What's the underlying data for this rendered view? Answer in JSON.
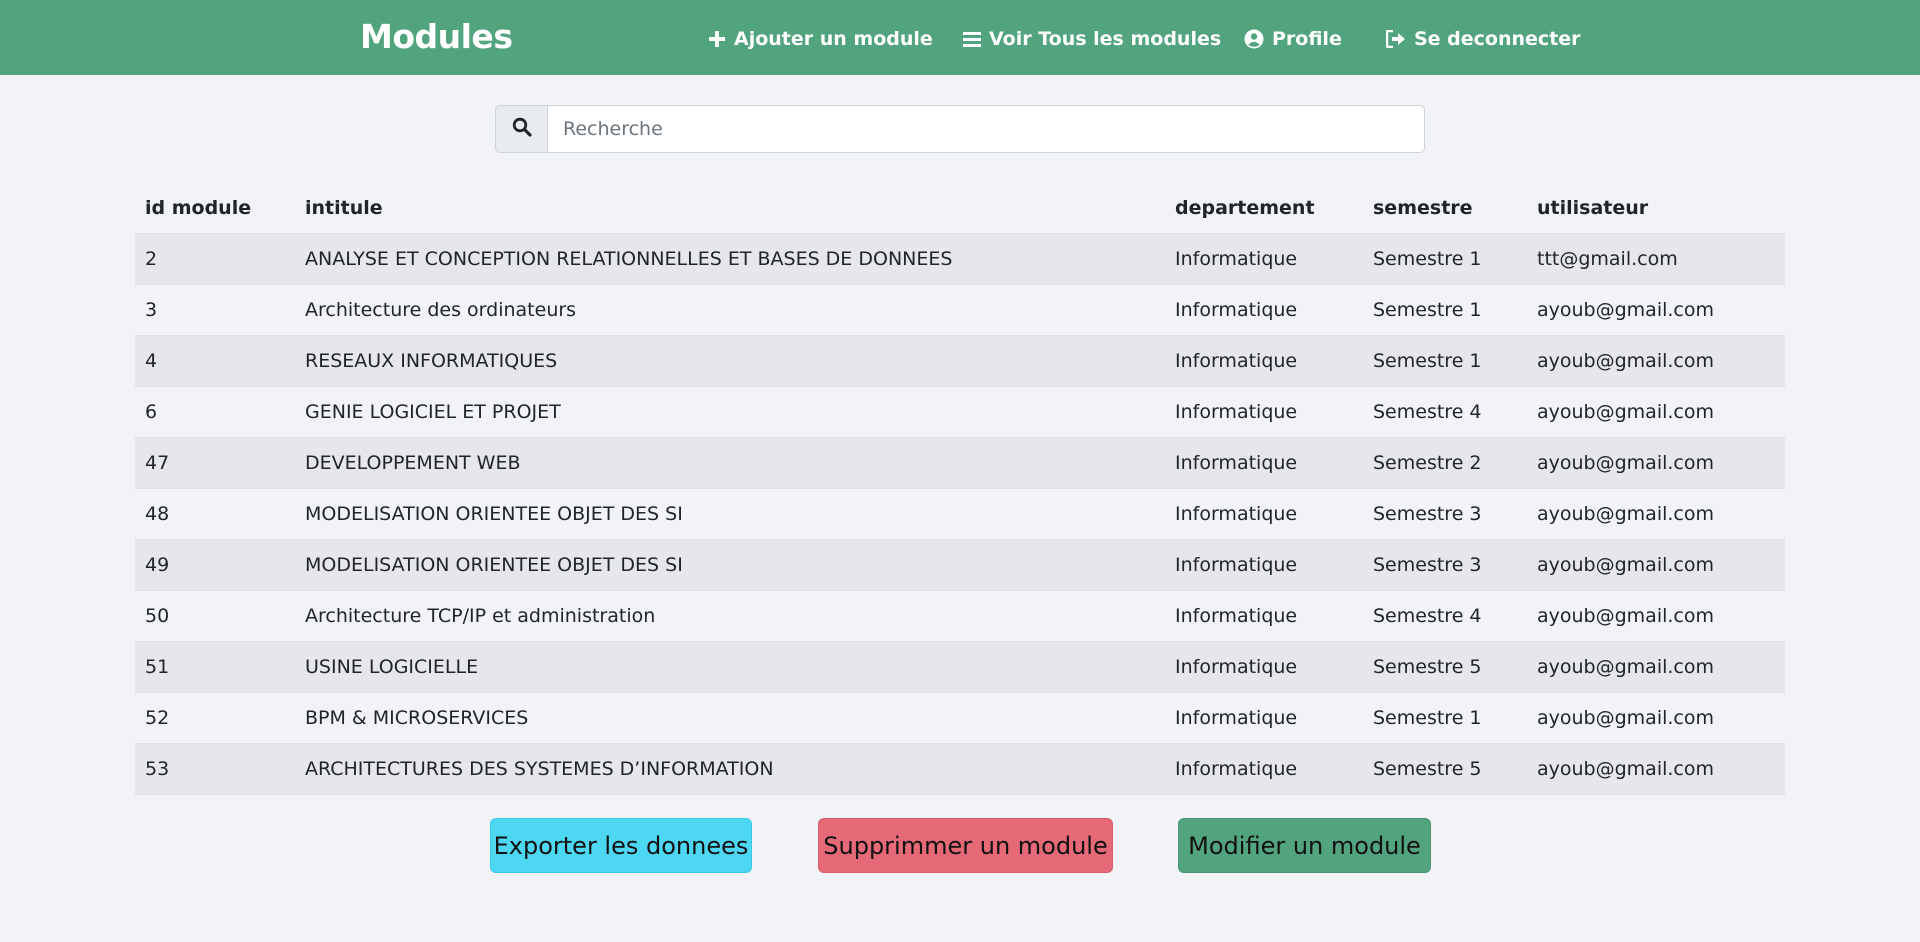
{
  "colors": {
    "navbar": "#52a47e",
    "page_background": "#f1f3f6",
    "export_button": "#4dd7f3",
    "delete_button": "#e56977",
    "edit_button": "#52a47e"
  },
  "nav": {
    "brand": "Modules",
    "links": [
      {
        "label": "Ajouter un module",
        "icon": "plus-icon"
      },
      {
        "label": "Voir Tous les modules",
        "icon": "list-icon"
      },
      {
        "label": "Profile",
        "icon": "user-circle-icon"
      },
      {
        "label": "Se deconnecter",
        "icon": "sign-out-icon"
      }
    ]
  },
  "search": {
    "placeholder": "Recherche",
    "value": "",
    "icon": "search-icon"
  },
  "table": {
    "columns": [
      "id module",
      "intitule",
      "departement",
      "semestre",
      "utilisateur"
    ],
    "rows": [
      [
        "2",
        "ANALYSE ET CONCEPTION RELATIONNELLES ET BASES DE DONNEES",
        "Informatique",
        "Semestre 1",
        "ttt@gmail.com"
      ],
      [
        "3",
        "Architecture des ordinateurs",
        "Informatique",
        "Semestre 1",
        "ayoub@gmail.com"
      ],
      [
        "4",
        "RESEAUX INFORMATIQUES",
        "Informatique",
        "Semestre 1",
        "ayoub@gmail.com"
      ],
      [
        "6",
        "GENIE LOGICIEL ET PROJET",
        "Informatique",
        "Semestre 4",
        "ayoub@gmail.com"
      ],
      [
        "47",
        "DEVELOPPEMENT WEB",
        "Informatique",
        "Semestre 2",
        "ayoub@gmail.com"
      ],
      [
        "48",
        "MODELISATION ORIENTEE OBJET DES SI",
        "Informatique",
        "Semestre 3",
        "ayoub@gmail.com"
      ],
      [
        "49",
        "MODELISATION ORIENTEE OBJET DES SI",
        "Informatique",
        "Semestre 3",
        "ayoub@gmail.com"
      ],
      [
        "50",
        "Architecture TCP/IP et administration",
        "Informatique",
        "Semestre 4",
        "ayoub@gmail.com"
      ],
      [
        "51",
        "USINE LOGICIELLE",
        "Informatique",
        "Semestre 5",
        "ayoub@gmail.com"
      ],
      [
        "52",
        "BPM & MICROSERVICES",
        "Informatique",
        "Semestre 1",
        "ayoub@gmail.com"
      ],
      [
        "53",
        "ARCHITECTURES DES SYSTEMES D’INFORMATION",
        "Informatique",
        "Semestre 5",
        "ayoub@gmail.com"
      ]
    ]
  },
  "actions": {
    "export_label": "Exporter les donnees",
    "delete_label": "Supprimmer un module",
    "edit_label": "Modifier un module"
  }
}
